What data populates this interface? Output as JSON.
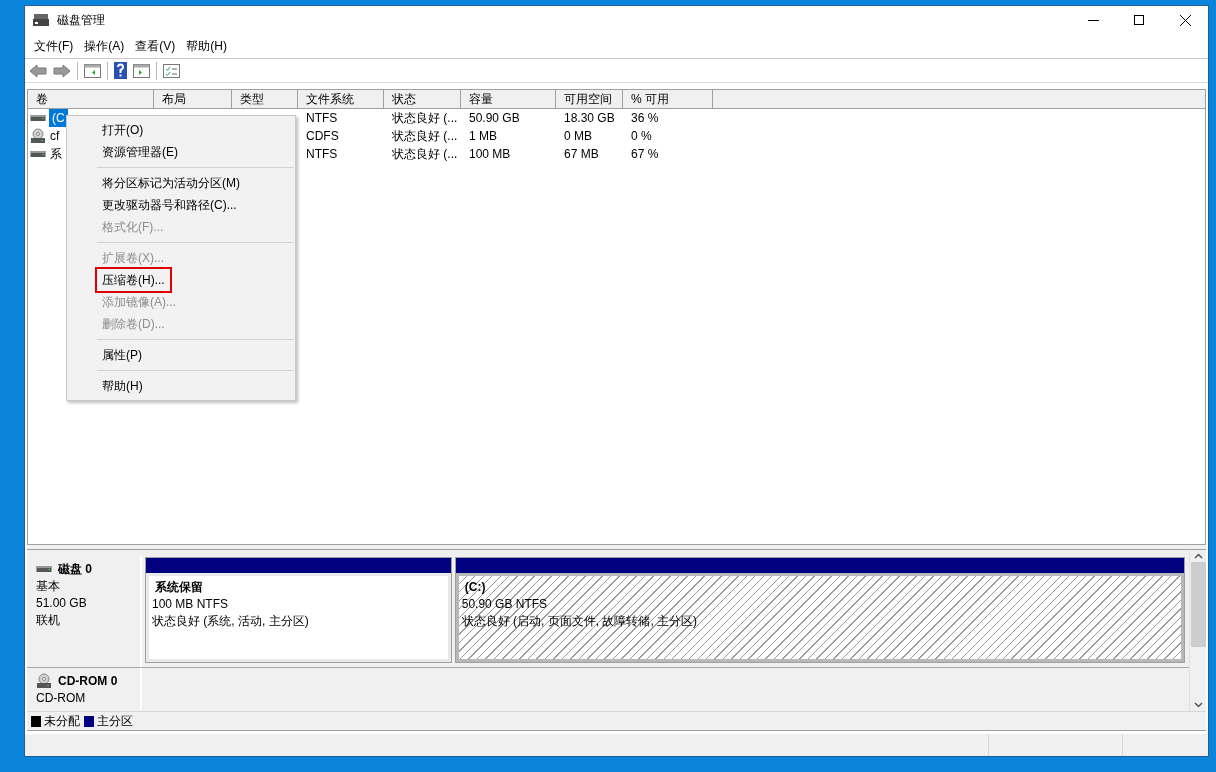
{
  "window": {
    "title": "磁盘管理"
  },
  "menu_bar": [
    "文件(F)",
    "操作(A)",
    "查看(V)",
    "帮助(H)"
  ],
  "volume_table": {
    "columns": [
      "卷",
      "布局",
      "类型",
      "文件系统",
      "状态",
      "容量",
      "可用空间",
      "% 可用"
    ],
    "rows": [
      {
        "kind": "disk",
        "selected": true,
        "cells": [
          "(C",
          "",
          "",
          "NTFS",
          "状态良好 (...",
          "50.90 GB",
          "18.30 GB",
          "36 %"
        ]
      },
      {
        "kind": "cd",
        "selected": false,
        "cells": [
          "cf",
          "",
          "",
          "CDFS",
          "状态良好 (...",
          "1 MB",
          "0 MB",
          "0 %"
        ]
      },
      {
        "kind": "disk",
        "selected": false,
        "cells": [
          "系",
          "",
          "",
          "NTFS",
          "状态良好 (...",
          "100 MB",
          "67 MB",
          "67 %"
        ]
      }
    ]
  },
  "context_menu": [
    {
      "kind": "item",
      "label": "打开(O)",
      "disabled": false,
      "highlighted": false
    },
    {
      "kind": "item",
      "label": "资源管理器(E)",
      "disabled": false,
      "highlighted": false
    },
    {
      "kind": "separator"
    },
    {
      "kind": "item",
      "label": "将分区标记为活动分区(M)",
      "disabled": false,
      "highlighted": false
    },
    {
      "kind": "item",
      "label": "更改驱动器号和路径(C)...",
      "disabled": false,
      "highlighted": false
    },
    {
      "kind": "item",
      "label": "格式化(F)...",
      "disabled": true,
      "highlighted": false
    },
    {
      "kind": "separator"
    },
    {
      "kind": "item",
      "label": "扩展卷(X)...",
      "disabled": true,
      "highlighted": false
    },
    {
      "kind": "item",
      "label": "压缩卷(H)...",
      "disabled": false,
      "highlighted": true
    },
    {
      "kind": "item",
      "label": "添加镜像(A)...",
      "disabled": true,
      "highlighted": false
    },
    {
      "kind": "item",
      "label": "删除卷(D)...",
      "disabled": true,
      "highlighted": false
    },
    {
      "kind": "separator"
    },
    {
      "kind": "item",
      "label": "属性(P)",
      "disabled": false,
      "highlighted": false
    },
    {
      "kind": "separator"
    },
    {
      "kind": "item",
      "label": "帮助(H)",
      "disabled": false,
      "highlighted": false
    }
  ],
  "disks": [
    {
      "kind": "disk",
      "name": "磁盘 0",
      "lines": [
        "基本",
        "51.00 GB",
        "联机"
      ],
      "partitions": [
        {
          "name": "系统保留",
          "size": "100 MB NTFS",
          "status": "状态良好 (系统, 活动, 主分区)",
          "selected": false
        },
        {
          "name": "(C:)",
          "size": "50.90 GB NTFS",
          "status": "状态良好 (启动, 页面文件, 故障转储, 主分区)",
          "selected": true
        }
      ]
    },
    {
      "kind": "cd",
      "name": "CD-ROM 0",
      "lines": [
        "CD-ROM"
      ]
    }
  ],
  "legend": [
    {
      "label": "未分配",
      "color": "#000000"
    },
    {
      "label": "主分区",
      "color": "#000080"
    }
  ]
}
